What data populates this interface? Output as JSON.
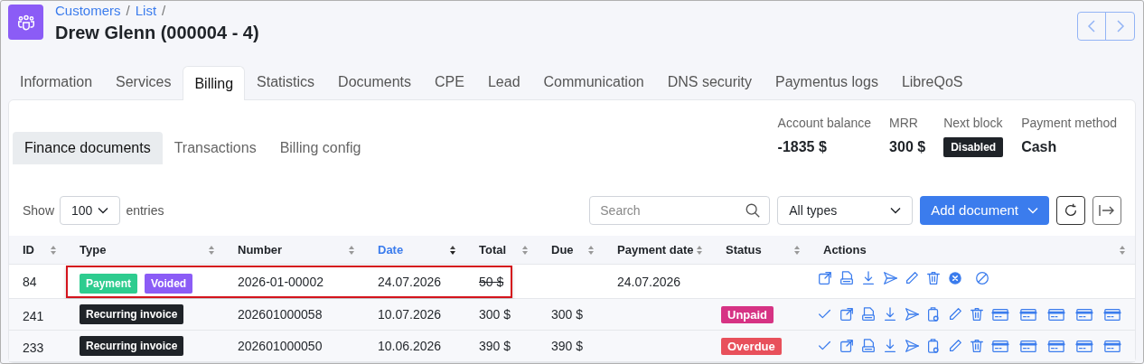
{
  "breadcrumbs": [
    {
      "label": "Customers",
      "separator": "/"
    },
    {
      "label": "List",
      "separator": "/"
    }
  ],
  "title": "Drew Glenn (000004 - 4)",
  "tabs": [
    {
      "label": "Information",
      "selected": false
    },
    {
      "label": "Services",
      "selected": false
    },
    {
      "label": "Billing",
      "selected": true
    },
    {
      "label": "Statistics",
      "selected": false
    },
    {
      "label": "Documents",
      "selected": false
    },
    {
      "label": "CPE",
      "selected": false
    },
    {
      "label": "Lead",
      "selected": false
    },
    {
      "label": "Communication",
      "selected": false
    },
    {
      "label": "DNS security",
      "selected": false
    },
    {
      "label": "Paymentus logs",
      "selected": false
    },
    {
      "label": "LibreQoS",
      "selected": false
    }
  ],
  "subtabs": [
    {
      "label": "Finance documents",
      "selected": true
    },
    {
      "label": "Transactions",
      "selected": false
    },
    {
      "label": "Billing config",
      "selected": false
    }
  ],
  "summary": [
    {
      "label": "Account balance",
      "kind": "text",
      "value": "-1835 $"
    },
    {
      "label": "MRR",
      "kind": "text",
      "value": "300 $"
    },
    {
      "label": "Next block",
      "kind": "badge",
      "value": "Disabled"
    },
    {
      "label": "Payment method",
      "kind": "text",
      "value": "Cash"
    }
  ],
  "toolbar": {
    "show_label": "Show",
    "page_size": "100",
    "entries_label": "entries",
    "search": {
      "placeholder": "Search"
    },
    "type_filter": "All types",
    "add_button": "Add document"
  },
  "table": {
    "columns": [
      {
        "label": "ID",
        "sorted": false
      },
      {
        "label": "Type",
        "sorted": false
      },
      {
        "label": "Number",
        "sorted": false
      },
      {
        "label": "Date",
        "sorted": true
      },
      {
        "label": "Total",
        "sorted": false
      },
      {
        "label": "Due",
        "sorted": false
      },
      {
        "label": "Payment date",
        "sorted": false
      },
      {
        "label": "Status",
        "sorted": false
      },
      {
        "label": "Actions",
        "sorted": false
      }
    ],
    "rows": [
      {
        "id": "84",
        "highlighted": true,
        "types": [
          {
            "label": "Payment",
            "color": "#2ecc8f"
          },
          {
            "label": "Voided",
            "color": "#8b5cf6"
          }
        ],
        "number": "2026-01-00002",
        "date": "24.07.2026",
        "total": "50 $",
        "total_struck": true,
        "payment_date": "24.07.2026",
        "actions": [
          {
            "kind": "open"
          },
          {
            "kind": "pdf"
          },
          {
            "kind": "download"
          },
          {
            "kind": "send"
          },
          {
            "kind": "edit"
          },
          {
            "kind": "delete"
          },
          {
            "kind": "cancel"
          },
          {
            "kind": "void"
          }
        ]
      },
      {
        "id": "241",
        "highlighted": false,
        "types": [
          {
            "label": "Recurring invoice",
            "color": "#1f2328"
          }
        ],
        "number": "202601000058",
        "date": "10.07.2026",
        "total": "300 $",
        "total_struck": false,
        "due": "300 $",
        "status": {
          "label": "Unpaid",
          "color": "#d63384"
        },
        "actions": [
          {
            "kind": "check"
          },
          {
            "kind": "open"
          },
          {
            "kind": "pdf"
          },
          {
            "kind": "download"
          },
          {
            "kind": "send"
          },
          {
            "kind": "clipboard"
          },
          {
            "kind": "edit"
          },
          {
            "kind": "delete"
          },
          {
            "kind": "card"
          },
          {
            "kind": "card"
          },
          {
            "kind": "card"
          },
          {
            "kind": "card"
          },
          {
            "kind": "card"
          }
        ]
      },
      {
        "id": "233",
        "highlighted": false,
        "types": [
          {
            "label": "Recurring invoice",
            "color": "#1f2328"
          }
        ],
        "number": "202601000050",
        "date": "10.06.2026",
        "total": "390 $",
        "total_struck": false,
        "due": "390 $",
        "status": {
          "label": "Overdue",
          "color": "#e8505b"
        },
        "actions": [
          {
            "kind": "check"
          },
          {
            "kind": "open"
          },
          {
            "kind": "pdf"
          },
          {
            "kind": "download"
          },
          {
            "kind": "send"
          },
          {
            "kind": "clipboard"
          },
          {
            "kind": "edit"
          },
          {
            "kind": "delete"
          },
          {
            "kind": "card"
          },
          {
            "kind": "card"
          },
          {
            "kind": "card"
          },
          {
            "kind": "card"
          },
          {
            "kind": "card"
          }
        ]
      }
    ]
  }
}
